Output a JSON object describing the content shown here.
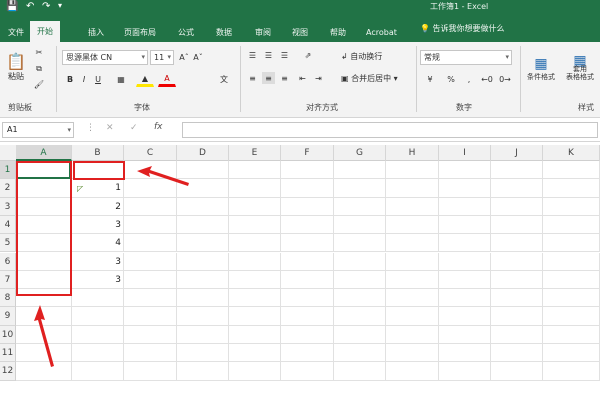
{
  "window": {
    "title": "工作簿1 - Excel"
  },
  "tabs": [
    {
      "label": "文件",
      "active": false
    },
    {
      "label": "开始",
      "active": true
    },
    {
      "label": "插入",
      "active": false
    },
    {
      "label": "页面布局",
      "active": false
    },
    {
      "label": "公式",
      "active": false
    },
    {
      "label": "数据",
      "active": false
    },
    {
      "label": "审阅",
      "active": false
    },
    {
      "label": "视图",
      "active": false
    },
    {
      "label": "帮助",
      "active": false
    },
    {
      "label": "Acrobat",
      "active": false
    }
  ],
  "tellme": "告诉我你想要做什么",
  "ribbon": {
    "clipboard": {
      "label": "剪贴板",
      "paste": "粘贴"
    },
    "font": {
      "label": "字体",
      "name": "思源黑体 CN",
      "size": "11"
    },
    "alignment": {
      "label": "对齐方式",
      "wrap": "自动换行",
      "merge": "合并后居中"
    },
    "number": {
      "label": "数字",
      "format": "常规"
    },
    "styles": {
      "label": "样式",
      "conditional": "条件格式",
      "table": "套用\n表格格式"
    }
  },
  "formula_bar": {
    "name_box": "A1",
    "value": ""
  },
  "columns": [
    "A",
    "B",
    "C",
    "D",
    "E",
    "F",
    "G",
    "H",
    "I",
    "J",
    "K"
  ],
  "rows": [
    "1",
    "2",
    "3",
    "4",
    "5",
    "6",
    "7",
    "8",
    "9",
    "10",
    "11",
    "12"
  ],
  "cells_b": [
    "",
    "1",
    "2",
    "3",
    "4",
    "3",
    "3"
  ],
  "colors": {
    "excel_green": "#217346",
    "highlight_red": "#e02020"
  }
}
